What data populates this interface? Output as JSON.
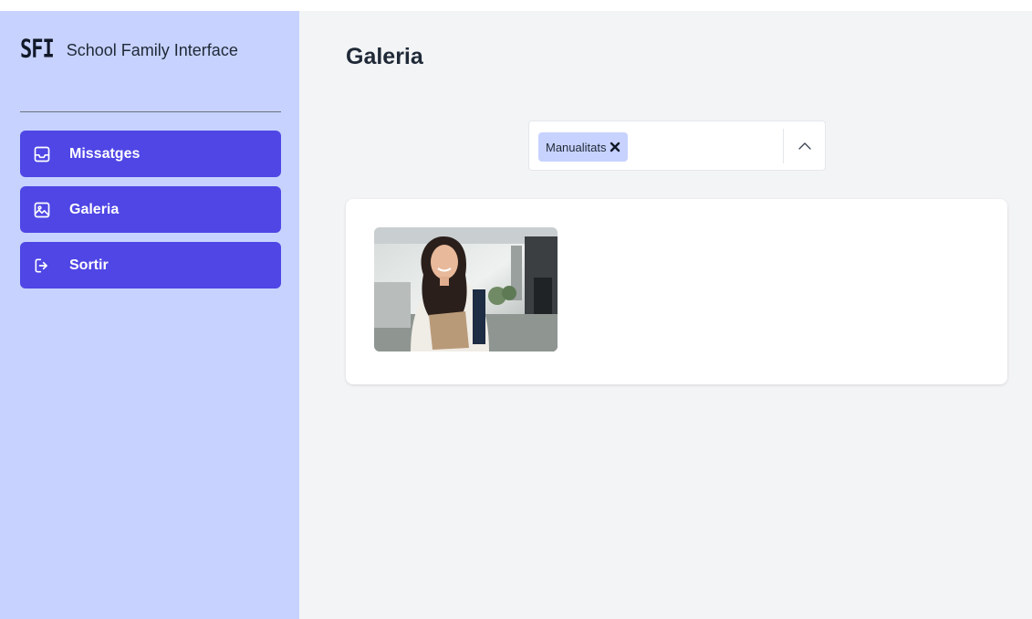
{
  "brand": {
    "logo": "SFI",
    "title": "School Family Interface"
  },
  "sidebar": {
    "items": [
      {
        "label": "Missatges",
        "icon": "inbox-icon"
      },
      {
        "label": "Galeria",
        "icon": "image-icon"
      },
      {
        "label": "Sortir",
        "icon": "logout-icon"
      }
    ]
  },
  "main": {
    "title": "Galeria",
    "filter": {
      "selected_tag": "Manualitats",
      "remove_icon": "close-icon",
      "toggle_icon": "chevron-up-icon"
    },
    "gallery": {
      "images": [
        {
          "subject": "photo-thumbnail"
        }
      ]
    }
  },
  "colors": {
    "sidebar_bg": "#c7d2fe",
    "accent": "#4f46e5",
    "main_bg": "#f3f4f6",
    "tag_bg": "#c7d2fe"
  }
}
